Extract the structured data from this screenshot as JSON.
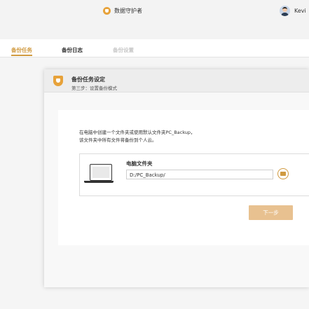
{
  "app": {
    "title": "数据守护者",
    "user_name": "Kevi"
  },
  "tabs": [
    {
      "label": "备份任务"
    },
    {
      "label": "备份日志"
    },
    {
      "label": "备份设置"
    }
  ],
  "dialog": {
    "title": "备份任务设定",
    "subtitle": "第三步：设置备份模式",
    "desc_line1": "在电脑中创建一个文件夹或使用默认文件夹PC_Backup，",
    "desc_line2": "该文件夹中所有文件将备份到个人云。",
    "folder_label": "电脑文件夹",
    "folder_path": "D:/PC_Backup/",
    "next_label": "下一步"
  },
  "colors": {
    "accent": "#d09a40",
    "next_button": "#e8c190"
  }
}
